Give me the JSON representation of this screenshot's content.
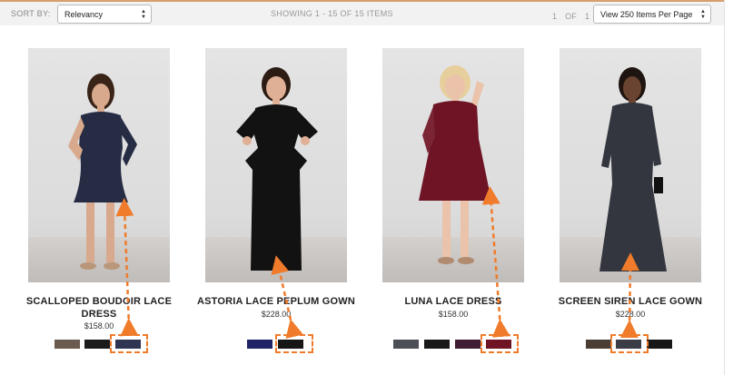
{
  "toolbar": {
    "sort_label": "SORT BY:",
    "sort_value": "Relevancy",
    "showing_text": "SHOWING 1 - 15 OF 15 ITEMS",
    "page_current": "1",
    "page_of": "OF",
    "page_total": "1",
    "per_page_value": "View 250 Items Per Page"
  },
  "products": [
    {
      "name": "SCALLOPED BOUDOIR LACE DRESS",
      "price": "$158.00",
      "dress_color": "#262c44",
      "swatches": [
        "#6b5a4e",
        "#1b1b1b",
        "#2d3552"
      ],
      "selected_swatch": 2
    },
    {
      "name": "ASTORIA LACE PEPLUM GOWN",
      "price": "$228.00",
      "dress_color": "#121212",
      "swatches": [
        "#1f2466",
        "#161616"
      ],
      "selected_swatch": 1
    },
    {
      "name": "LUNA LACE DRESS",
      "price": "$158.00",
      "dress_color": "#6e1424",
      "swatches": [
        "#4c4f56",
        "#191919",
        "#3f1c33",
        "#6e1424"
      ],
      "selected_swatch": 3
    },
    {
      "name": "SCREEN SIREN LACE GOWN",
      "price": "$228.00",
      "dress_color": "#33363e",
      "swatches": [
        "#4a3d33",
        "#3a3d45",
        "#171717"
      ],
      "selected_swatch": 1
    }
  ],
  "annotation_color": "#f07b2a"
}
